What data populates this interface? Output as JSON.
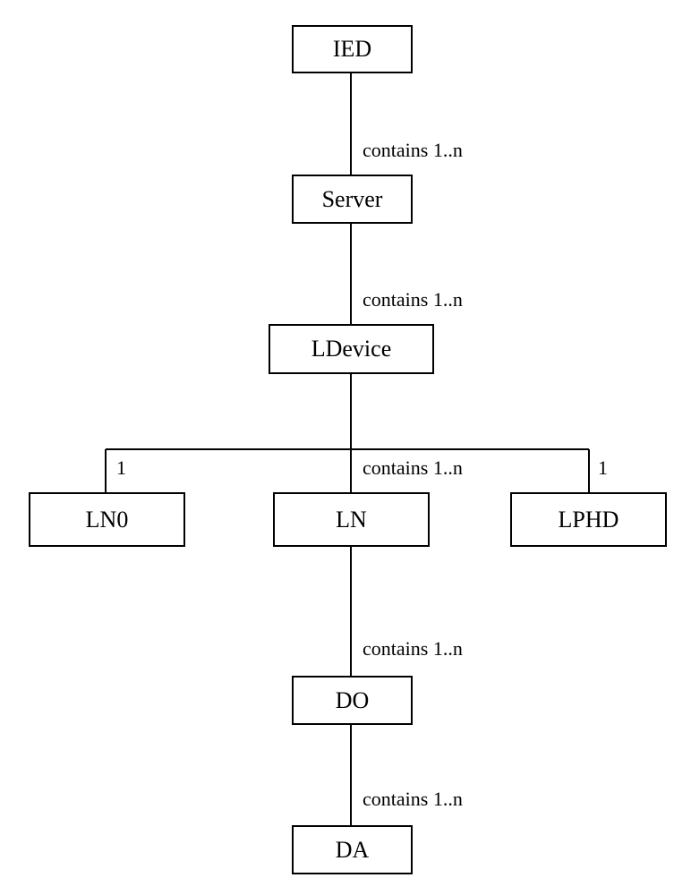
{
  "nodes": {
    "ied": "IED",
    "server": "Server",
    "ldevice": "LDevice",
    "ln0": "LN0",
    "ln": "LN",
    "lphd": "LPHD",
    "do": "DO",
    "da": "DA"
  },
  "edges": {
    "ied_server": "contains 1..n",
    "server_ldevice": "contains 1..n",
    "ldevice_ln0": "1",
    "ldevice_ln": "contains 1..n",
    "ldevice_lphd": "1",
    "ln_do": "contains 1..n",
    "do_da": "contains 1..n"
  }
}
